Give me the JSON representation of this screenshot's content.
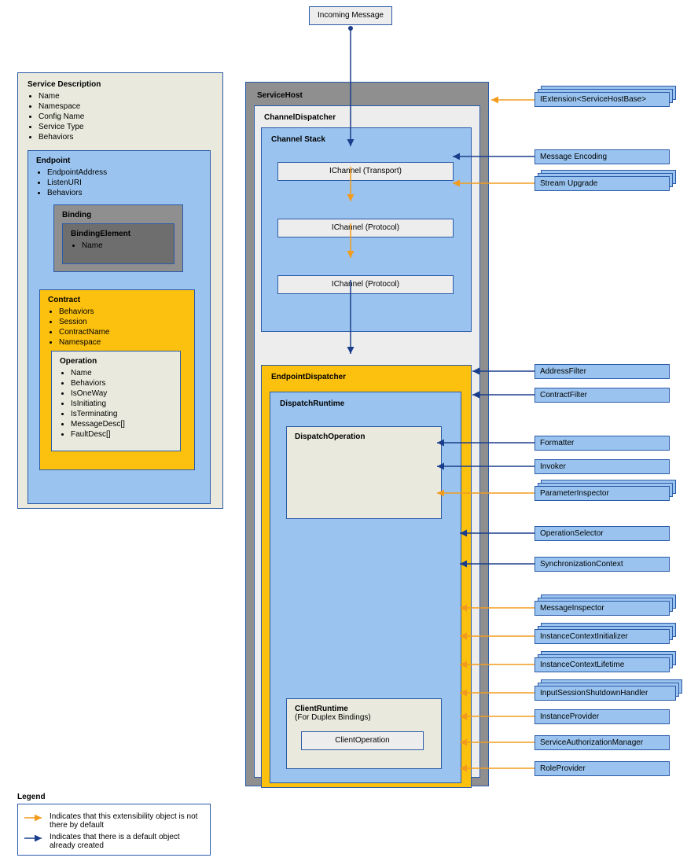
{
  "incoming": {
    "label": "Incoming Message"
  },
  "serviceDescription": {
    "title": "Service Description",
    "items": [
      "Name",
      "Namespace",
      "Config Name",
      "Service Type",
      "Behaviors"
    ],
    "endpoint": {
      "title": "Endpoint",
      "items": [
        "EndpointAddress",
        "ListenURI",
        "Behaviors"
      ],
      "binding": {
        "title": "Binding",
        "bindingElement": {
          "title": "BindingElement",
          "items": [
            "Name"
          ]
        }
      },
      "contract": {
        "title": "Contract",
        "items": [
          "Behaviors",
          "Session",
          "ContractName",
          "Namespace"
        ],
        "operation": {
          "title": "Operation",
          "items": [
            "Name",
            "Behaviors",
            "IsOneWay",
            "IsInitiating",
            "IsTerminating",
            "MessageDesc[]",
            "FaultDesc[]"
          ]
        }
      }
    }
  },
  "serviceHost": {
    "title": "ServiceHost"
  },
  "channelDispatcher": {
    "title": "ChannelDispatcher"
  },
  "channelStack": {
    "title": "Channel Stack",
    "ch1": "IChannel (Transport)",
    "ch2": "IChannel (Protocol)",
    "ch3": "IChannel (Protocol)"
  },
  "endpointDispatcher": {
    "title": "EndpointDispatcher"
  },
  "dispatchRuntime": {
    "title": "DispatchRuntime"
  },
  "dispatchOperation": {
    "title": "DispatchOperation"
  },
  "clientRuntime": {
    "title": "ClientRuntime",
    "subtitle": "(For Duplex Bindings)"
  },
  "clientOperation": {
    "title": "ClientOperation"
  },
  "ext": {
    "iextension": "IExtension<ServiceHostBase>",
    "msgEncoding": "Message Encoding",
    "streamUpgrade": "Stream Upgrade",
    "addressFilter": "AddressFilter",
    "contractFilter": "ContractFilter",
    "formatter": "Formatter",
    "invoker": "Invoker",
    "paramInspector": "ParameterInspector",
    "operationSelector": "OperationSelector",
    "syncContext": "SynchronizationContext",
    "msgInspector": "MessageInspector",
    "instCtxInit": "InstanceContextInitializer",
    "instCtxLifetime": "InstanceContextLifetime",
    "inputSessShutdown": "InputSessionShutdownHandler",
    "instProvider": "InstanceProvider",
    "svcAuthzMgr": "ServiceAuthorizationManager",
    "roleProvider": "RoleProvider"
  },
  "legend": {
    "title": "Legend",
    "orange": "Indicates that this extensibility object is not there by default",
    "blue": "Indicates that there is a default object already created"
  }
}
